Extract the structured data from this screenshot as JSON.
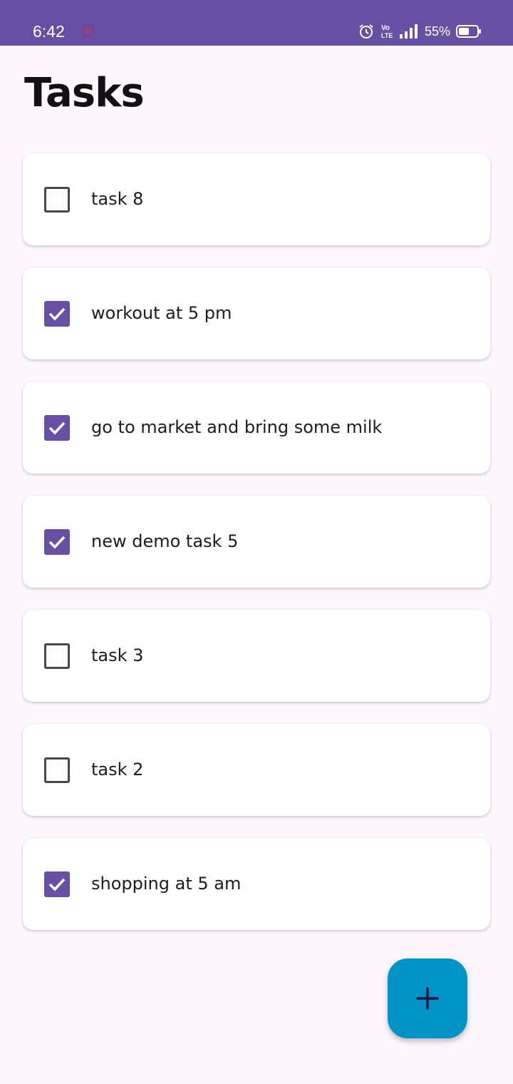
{
  "status_bar": {
    "time": "6:42",
    "battery_percent": "55%",
    "network_label": "Vo LTE",
    "background_color": "#6750a4",
    "icons": [
      "notification-icon",
      "alarm-icon",
      "volte-icon",
      "signal-icon",
      "battery-icon"
    ]
  },
  "page": {
    "title": "Tasks"
  },
  "tasks": [
    {
      "label": "task 8",
      "checked": false
    },
    {
      "label": "workout at 5 pm",
      "checked": true
    },
    {
      "label": "go to market and bring some milk",
      "checked": true
    },
    {
      "label": "new demo task 5",
      "checked": true
    },
    {
      "label": "task 3",
      "checked": false
    },
    {
      "label": "task 2",
      "checked": false
    },
    {
      "label": "shopping at 5 am",
      "checked": true
    }
  ],
  "fab": {
    "icon": "plus-icon",
    "color": "#0094c6"
  },
  "colors": {
    "accent": "#6750a4",
    "background": "#fdf7fd",
    "card": "#ffffff"
  }
}
